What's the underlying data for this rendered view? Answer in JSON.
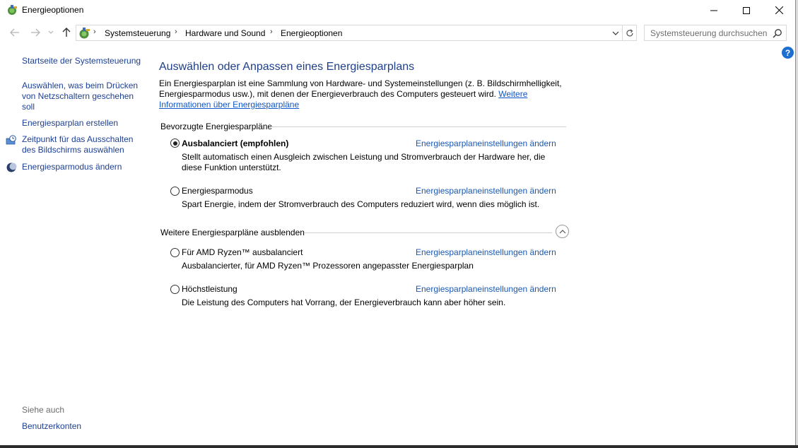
{
  "window": {
    "title": "Energieoptionen"
  },
  "breadcrumbs": [
    "Systemsteuerung",
    "Hardware und Sound",
    "Energieoptionen"
  ],
  "search": {
    "placeholder": "Systemsteuerung durchsuchen"
  },
  "help": {
    "label": "?"
  },
  "sidebar": {
    "items": [
      {
        "label": "Startseite der Systemsteuerung",
        "icon": ""
      },
      {
        "label": "Auswählen, was beim Drücken von Netzschaltern geschehen soll",
        "icon": ""
      },
      {
        "label": "Energiesparplan erstellen",
        "icon": ""
      },
      {
        "label": "Zeitpunkt für das Ausschalten des Bildschirms auswählen",
        "icon": "monitor-clock-icon"
      },
      {
        "label": "Energiesparmodus ändern",
        "icon": "moon-icon"
      }
    ],
    "see_also_label": "Siehe auch",
    "see_also_items": [
      {
        "label": "Benutzerkonten"
      }
    ]
  },
  "main": {
    "heading": "Auswählen oder Anpassen eines Energiesparplans",
    "intro_text": "Ein Energiesparplan ist eine Sammlung von Hardware- und Systemeinstellungen (z. B. Bildschirmhelligkeit, Energiesparmodus usw.), mit denen der Energieverbrauch des Computers gesteuert wird. ",
    "intro_link": "Weitere Informationen über Energiesparpläne",
    "preferred_group_label": "Bevorzugte Energiesparpläne",
    "more_group_label": "Weitere Energiesparpläne ausblenden",
    "plan_link_label": "Energiesparplaneinstellungen ändern",
    "preferred_plans": [
      {
        "name": "Ausbalanciert (empfohlen)",
        "description": "Stellt automatisch einen Ausgleich zwischen Leistung und Stromverbrauch der Hardware her, die diese Funktion unterstützt.",
        "selected": true
      },
      {
        "name": "Energiesparmodus",
        "description": "Spart Energie, indem der Stromverbrauch des Computers reduziert wird, wenn dies möglich ist.",
        "selected": false
      }
    ],
    "more_plans": [
      {
        "name": "Für AMD Ryzen™ ausbalanciert",
        "description": "Ausbalancierter, für AMD Ryzen™ Prozessoren angepasster Energiesparplan",
        "selected": false
      },
      {
        "name": "Höchstleistung",
        "description": "Die Leistung des Computers hat Vorrang, der Energieverbrauch kann aber höher sein.",
        "selected": false
      }
    ]
  },
  "colors": {
    "link": "#1c3f94",
    "heading": "#1e3f8a",
    "help": "#1a6fd0"
  }
}
